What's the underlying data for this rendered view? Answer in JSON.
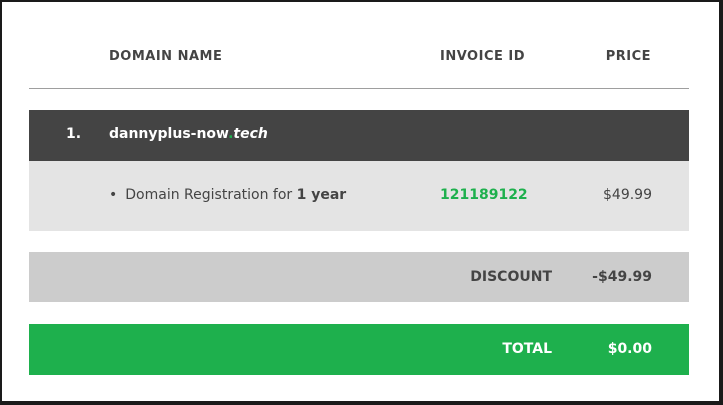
{
  "header": {
    "domain_name": "DOMAIN NAME",
    "invoice_id": "INVOICE ID",
    "price": "PRICE"
  },
  "domain": {
    "number": "1.",
    "name": "dannyplus-now",
    "dot": ".",
    "tld": "tech"
  },
  "item": {
    "bullet": "•",
    "description": "Domain Registration for",
    "term": "1 year",
    "invoice_id": "121189122",
    "price": "$49.99"
  },
  "discount": {
    "label": "DISCOUNT",
    "value": "-$49.99"
  },
  "total": {
    "label": "TOTAL",
    "value": "$0.00"
  },
  "colors": {
    "accent_green": "#1eb04d",
    "dark_row": "#444444",
    "item_row": "#e4e4e4",
    "discount_row": "#cccccc"
  }
}
